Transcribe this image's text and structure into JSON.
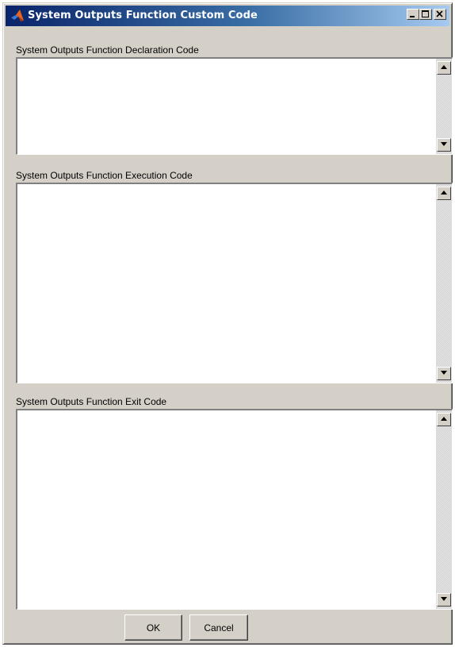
{
  "window": {
    "title": "System Outputs Function Custom Code",
    "app_icon": "matlab-logo-icon",
    "controls": [
      "minimize-icon",
      "maximize-icon",
      "close-icon"
    ]
  },
  "sections": [
    {
      "label": "System Outputs Function Declaration Code",
      "value": ""
    },
    {
      "label": "System Outputs Function Execution Code",
      "value": ""
    },
    {
      "label": "System Outputs Function Exit Code",
      "value": ""
    }
  ],
  "buttons": {
    "ok_label": "OK",
    "cancel_label": "Cancel"
  },
  "colors": {
    "titlebar_start": "#0a246a",
    "titlebar_end": "#a6caf0",
    "dialog_face": "#d4d0c8"
  }
}
